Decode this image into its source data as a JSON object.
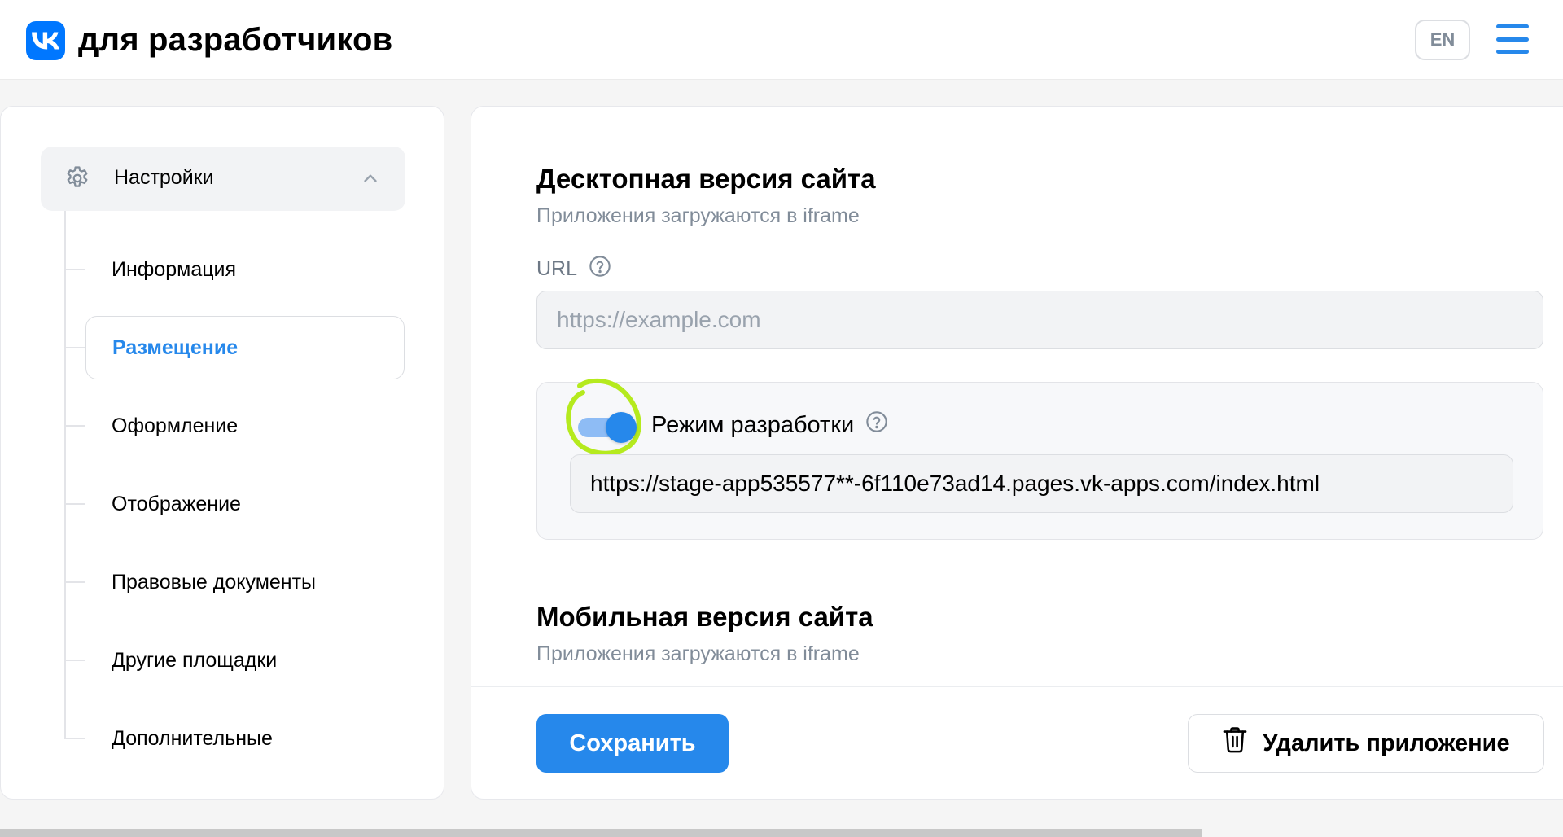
{
  "header": {
    "logo_icon": "vk-logo-icon",
    "brand": "для разработчиков",
    "lang_button": "EN",
    "menu_icon": "hamburger-menu-icon",
    "accent_color": "#0077ff"
  },
  "sidebar": {
    "group": {
      "icon": "gear-icon",
      "label": "Настройки",
      "expanded_icon": "chevron-up-icon"
    },
    "items": [
      {
        "label": "Информация",
        "active": false
      },
      {
        "label": "Размещение",
        "active": true
      },
      {
        "label": "Оформление",
        "active": false
      },
      {
        "label": "Отображение",
        "active": false
      },
      {
        "label": "Правовые документы",
        "active": false
      },
      {
        "label": "Другие площадки",
        "active": false
      },
      {
        "label": "Дополнительные",
        "active": false
      }
    ],
    "active_color": "#2688eb"
  },
  "main": {
    "desktop": {
      "title": "Десктопная версия сайта",
      "subtitle": "Приложения загружаются в iframe",
      "url_label": "URL",
      "url_help_icon": "question-circle-icon",
      "url_placeholder": "https://example.com",
      "dev_mode": {
        "enabled": true,
        "label": "Режим разработки",
        "help_icon": "question-circle-icon",
        "url_value": "https://stage-app535577**-6f110e73ad14.pages.vk-apps.com/index.html",
        "highlight_color": "#b5ea1e"
      }
    },
    "mobile": {
      "title": "Мобильная версия сайта",
      "subtitle": "Приложения загружаются в iframe"
    },
    "actions": {
      "save_label": "Сохранить",
      "delete_label": "Удалить приложение",
      "delete_icon": "trash-icon"
    }
  }
}
